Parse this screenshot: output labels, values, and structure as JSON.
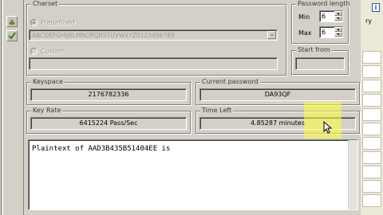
{
  "charset": {
    "group_label": "Charset",
    "predefined_label": "Predefined",
    "predefined_value": "ABCDEFGHIJKLMNOPQRSTUVWXYZ0123456789",
    "custom_label": "Custom",
    "custom_value": ""
  },
  "password_length": {
    "group_label": "Password length",
    "min_label": "Min",
    "min_value": "6",
    "max_label": "Max",
    "max_value": "6"
  },
  "start_from": {
    "group_label": "Start from",
    "value": ""
  },
  "keyspace": {
    "label": "Keyspace",
    "value": "2176782336"
  },
  "current_password": {
    "label": "Current password",
    "value": "DA93QF"
  },
  "key_rate": {
    "label": "Key Rate",
    "value": "6415224 Pass/Sec"
  },
  "time_left": {
    "label": "Time Left",
    "value": "4.85287 minutes"
  },
  "output": {
    "text": "Plaintext of AAD3B435B51404EE is"
  },
  "background_window": {
    "partial_text": "ry",
    "badge": "i"
  },
  "colors": {
    "dialog_bg": "#d4d0c8",
    "highlight": "#ffff3c"
  }
}
